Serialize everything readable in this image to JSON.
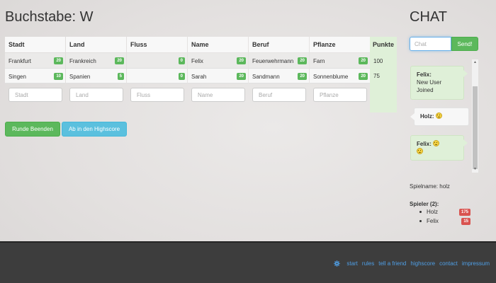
{
  "game": {
    "title": "Buchstabe: W",
    "columns": [
      {
        "header": "Stadt",
        "rows": [
          {
            "value": "Frankfurt",
            "points": "20"
          },
          {
            "value": "Singen",
            "points": "10"
          }
        ],
        "placeholder": "Stadt"
      },
      {
        "header": "Land",
        "rows": [
          {
            "value": "Frankreich",
            "points": "20"
          },
          {
            "value": "Spanien",
            "points": "5"
          }
        ],
        "placeholder": "Land"
      },
      {
        "header": "Fluss",
        "rows": [
          {
            "value": "",
            "points": "0"
          },
          {
            "value": "",
            "points": "0"
          }
        ],
        "placeholder": "Fluss"
      },
      {
        "header": "Name",
        "rows": [
          {
            "value": "Felix",
            "points": "20"
          },
          {
            "value": "Sarah",
            "points": "20"
          }
        ],
        "placeholder": "Name"
      },
      {
        "header": "Beruf",
        "rows": [
          {
            "value": "Feuerwehrmann",
            "points": "20"
          },
          {
            "value": "Sandmann",
            "points": "20"
          }
        ],
        "placeholder": "Beruf"
      },
      {
        "header": "Pflanze",
        "rows": [
          {
            "value": "Farn",
            "points": "20"
          },
          {
            "value": "Sonnenblume",
            "points": "20"
          }
        ],
        "placeholder": "Pflanze"
      }
    ],
    "punkte": {
      "header": "Punkte",
      "rows": [
        "100",
        "75"
      ]
    },
    "end_round_label": "Runde Beenden",
    "highscore_label": "Ab in den Highscore"
  },
  "chat": {
    "title": "CHAT",
    "input_placeholder": "Chat",
    "send_label": "Send!",
    "messages": [
      {
        "author": "Felix:",
        "text": "New User Joined"
      },
      {
        "author": "Holz:",
        "text": ""
      },
      {
        "author": "Felix:",
        "text": ""
      }
    ]
  },
  "player": {
    "spielname": "Spielname: holz",
    "players_header": "Spieler (2):",
    "players": [
      {
        "name": "Holz",
        "score": "175"
      },
      {
        "name": "Felix",
        "score": "15"
      }
    ]
  },
  "footer": {
    "links": [
      "start",
      "rules",
      "tell a friend",
      "highscore",
      "contact",
      "impressum"
    ]
  },
  "colors": {
    "success": "#5cb85c",
    "info": "#5bc0de",
    "danger": "#d9534f",
    "link": "#4f9fe6",
    "footer_bg": "#3d3d3d"
  }
}
